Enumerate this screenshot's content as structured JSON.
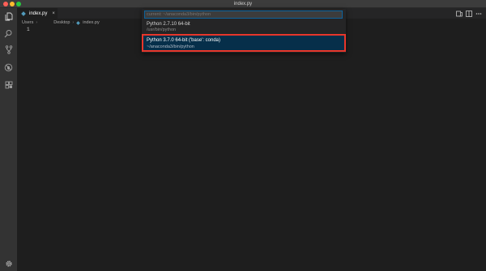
{
  "window": {
    "title": "index.py"
  },
  "activity_bar": {
    "items": [
      {
        "icon": "files-icon"
      },
      {
        "icon": "search-icon"
      },
      {
        "icon": "source-control-icon"
      },
      {
        "icon": "debug-icon"
      },
      {
        "icon": "extensions-icon"
      }
    ],
    "bottom_icon": "gear-icon"
  },
  "tabs": [
    {
      "label": "index.py",
      "close": "×"
    }
  ],
  "breadcrumb": {
    "segments": [
      "Users",
      "Desktop",
      "index.py"
    ],
    "separator": "›"
  },
  "editor": {
    "line_number": "1"
  },
  "quick_pick": {
    "placeholder": "current: ~/anaconda3/bin/python",
    "items": [
      {
        "label": "Python 2.7.10 64-bit",
        "detail": "/usr/bin/python",
        "selected": false
      },
      {
        "label": "Python 3.7.0 64-bit ('base': conda)",
        "detail": "~/anaconda3/bin/python",
        "selected": true
      }
    ]
  },
  "colors": {
    "accent": "#0e639c",
    "highlight_border": "#e8362b",
    "python_icon": "#519aba"
  }
}
